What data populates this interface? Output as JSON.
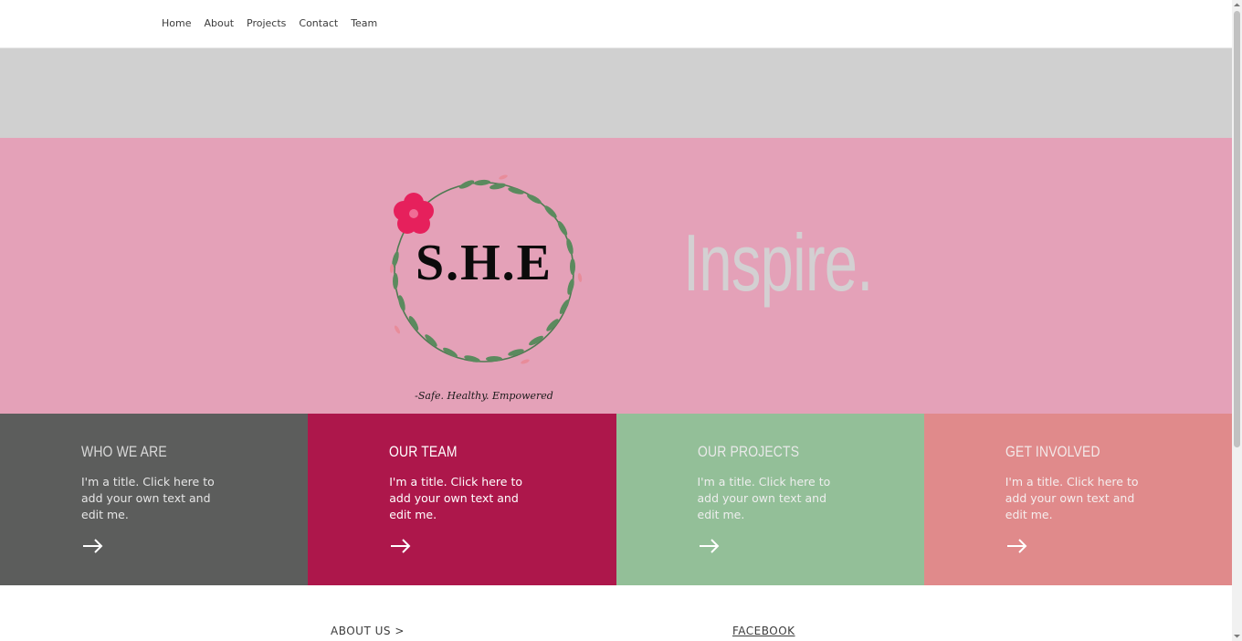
{
  "nav": {
    "items": [
      {
        "label": "Home"
      },
      {
        "label": "About"
      },
      {
        "label": "Projects"
      },
      {
        "label": "Contact"
      },
      {
        "label": "Team"
      }
    ]
  },
  "hero": {
    "logo_letters": "S.H.E",
    "logo_tagline": "-Safe. Healthy. Empowered",
    "title": "Inspire."
  },
  "tiles": [
    {
      "title": "WHO WE ARE",
      "text": "I'm a title. Click here to add your own text and edit me.",
      "color": "#5c5d5c",
      "title_color": "#d9d9d9",
      "text_color": "#e6e6e6"
    },
    {
      "title": "OUR TEAM",
      "text": "I'm a title. Click here to add your own text and edit me.",
      "color": "#ad174b",
      "title_color": "#ffffff",
      "text_color": "#ffffff"
    },
    {
      "title": "OUR PROJECTS",
      "text": "I'm a title. Click here to add your own text and edit me.",
      "color": "#93bf98",
      "title_color": "#e9e9e9",
      "text_color": "#eeeeee"
    },
    {
      "title": "GET INVOLVED",
      "text": "I'm a title. Click here to add your own text and edit me.",
      "color": "#e08a8b",
      "title_color": "#f3eaea",
      "text_color": "#f5eeee"
    }
  ],
  "footer": {
    "about_label": "ABOUT US >",
    "facebook_label": "FACEBOOK"
  },
  "colors": {
    "hero_bg": "#e4a1b8",
    "grey_band": "#d0d0d0",
    "hero_title": "#d3d0d2"
  }
}
